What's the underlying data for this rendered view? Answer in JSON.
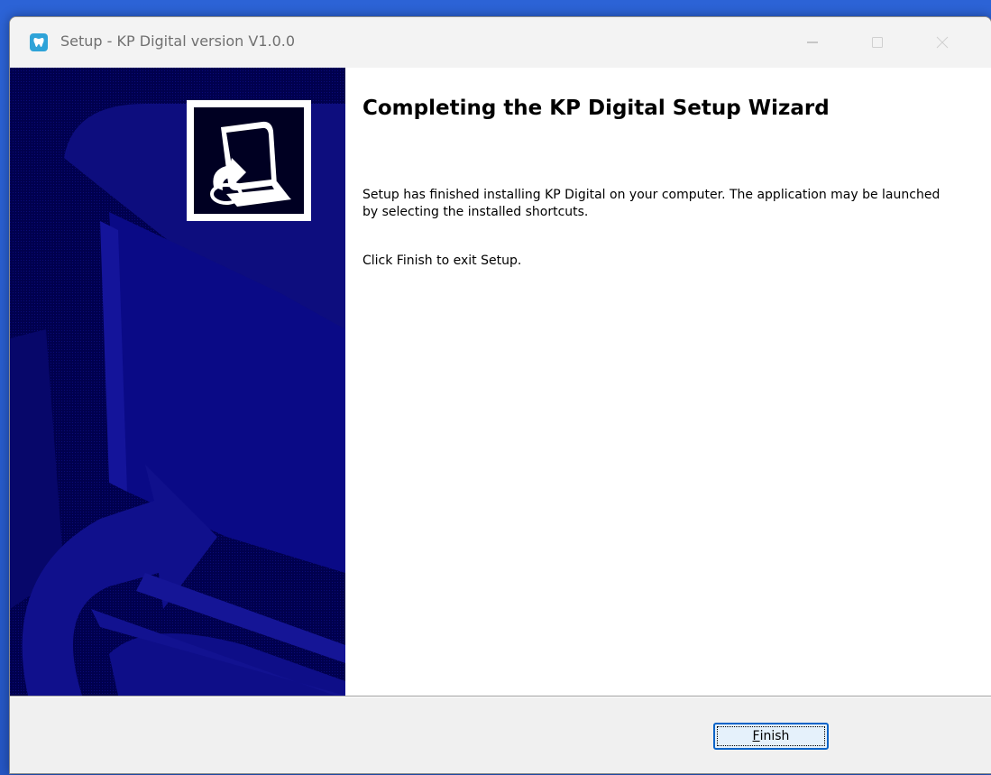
{
  "window": {
    "title": "Setup - KP Digital version V1.0.0",
    "app_icon": "tooth-app-icon",
    "controls": {
      "minimize_icon": "minimize-icon",
      "maximize_icon": "maximize-icon",
      "close_icon": "close-icon"
    }
  },
  "sidebar": {
    "background_color": "#00004e",
    "icon": "computer-install-icon"
  },
  "content": {
    "heading": "Completing the KP Digital Setup Wizard",
    "paragraph_1": "Setup has finished installing KP Digital on your computer. The application may be launched by selecting the installed shortcuts.",
    "paragraph_2": "Click Finish to exit Setup."
  },
  "footer": {
    "finish_button": {
      "mnemonic": "F",
      "rest": "inish"
    }
  },
  "colors": {
    "accent": "#0a64c8",
    "sidebar": "#00004e",
    "desktop": "#2556c4"
  }
}
